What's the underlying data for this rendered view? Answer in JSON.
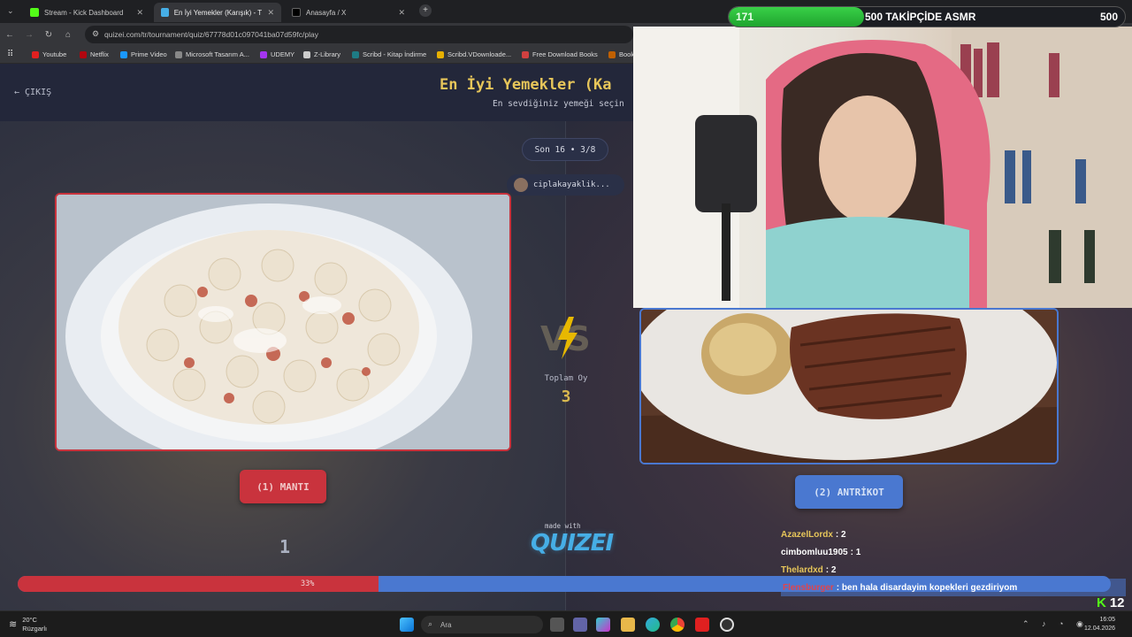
{
  "browser": {
    "tabs": [
      {
        "title": "Stream - Kick Dashboard",
        "active": false
      },
      {
        "title": "En İyi Yemekler (Karışık) - Tier L",
        "active": true
      },
      {
        "title": "Anasayfa / X",
        "active": false
      }
    ],
    "url": "quizei.com/tr/tournament/quiz/67778d01c097041ba07d59fc/play",
    "bookmarks": [
      "Youtube",
      "Netflix",
      "Prime Video",
      "Microsoft Tasarım A...",
      "UDEMY",
      "Z-Library",
      "Scribd - Kitap İndirme",
      "Scribd.VDownloade...",
      "Free Download Books",
      "Book"
    ]
  },
  "quiz": {
    "exit_label": "ÇIKIŞ",
    "title": "En İyi Yemekler (Ka",
    "subtitle": "En sevdiğiniz yemeği seçin",
    "round": "Son 16 • 3/8",
    "author": "ciplakayaklik...",
    "left_option": "(1) MANTI",
    "right_option": "(2) ANTRİKOT",
    "total_vote_label": "Toplam Oy",
    "total_vote_value": "3",
    "left_count": "1",
    "made_with": "made with",
    "brand": "QUIZEI",
    "progress_label": "33%",
    "progress_fraction": 0.33
  },
  "stream": {
    "follower_count": "171",
    "follower_goal_label": "500 TAKİPÇİDE ASMR",
    "follower_goal": "500",
    "follower_fraction": 0.342,
    "chat": [
      {
        "user": "AzazelLordx",
        "msg": ": 2",
        "color": "#e7c65a"
      },
      {
        "user": "cimbomluu1905",
        "msg": ": 1",
        "color": "#ffffff"
      },
      {
        "user": "Thelardxd",
        "msg": ": 2",
        "color": "#e7c65a"
      },
      {
        "user": "Flensburger",
        "msg": ": ben hala disardayim kopekleri gezdiriyom",
        "color": "#e0454d"
      }
    ],
    "viewer_count": "12"
  },
  "taskbar": {
    "temp": "20°C",
    "weather": "Rüzgarlı",
    "search": "Ara",
    "time": "16:05",
    "date": "12.04.2026"
  },
  "colors": {
    "red": "#c9333d",
    "blue": "#4a78d0",
    "gold": "#e7c65a",
    "kick_green": "#53fc18"
  }
}
